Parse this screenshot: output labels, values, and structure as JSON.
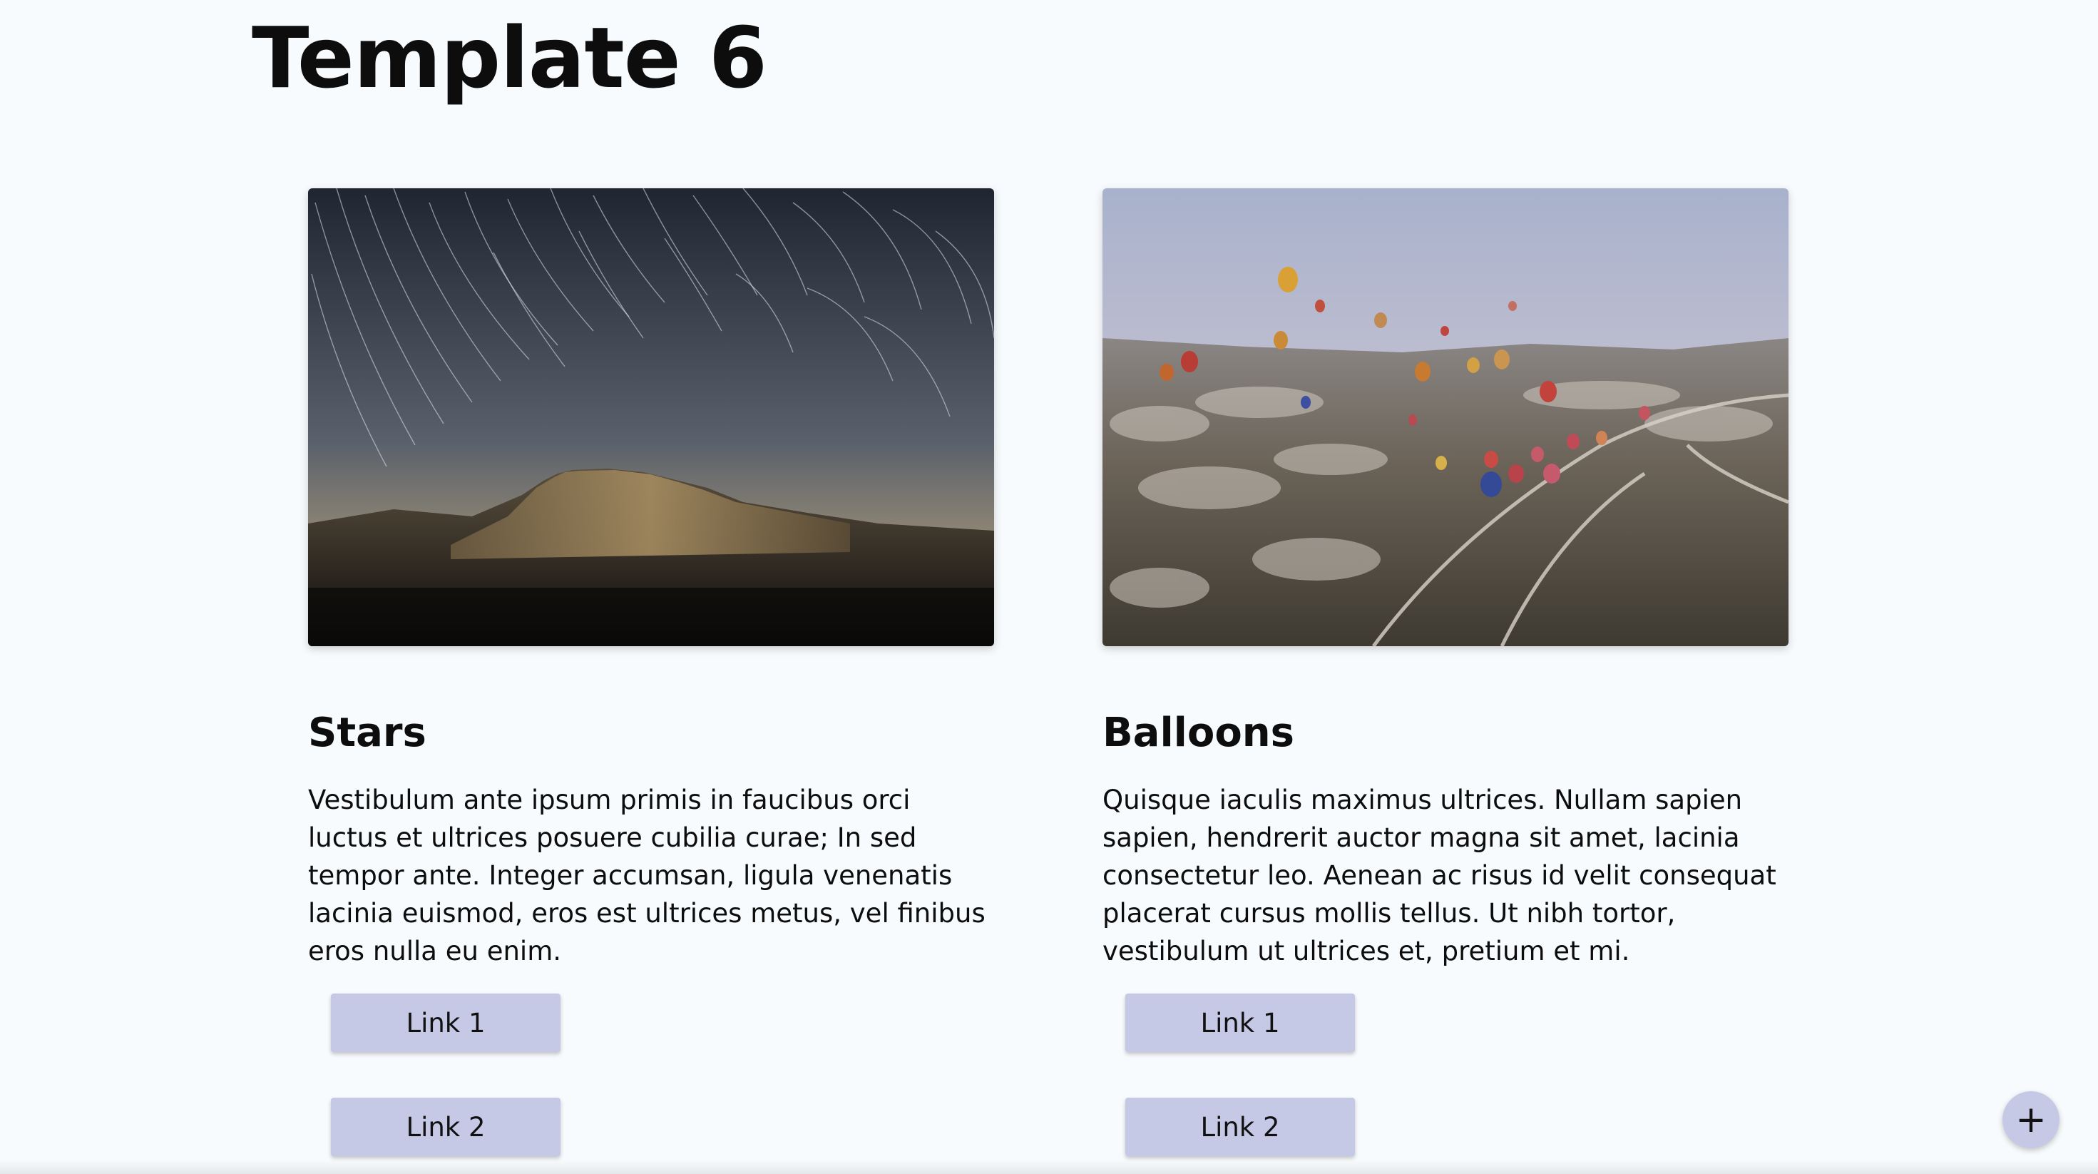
{
  "page": {
    "title": "Template 6"
  },
  "cards": [
    {
      "title": "Stars",
      "image_icon": "star-trails-photo",
      "text": "Vestibulum ante ipsum primis in faucibus orci luctus et ultrices posuere cubilia curae; In sed tempor ante. Integer accumsan, ligula venenatis lacinia euismod, eros est ultrices metus, vel finibus eros nulla eu enim.",
      "links": [
        "Link 1",
        "Link 2"
      ]
    },
    {
      "title": "Balloons",
      "image_icon": "hot-air-balloons-photo",
      "text": "Quisque iaculis maximus ultrices. Nullam sapien sapien, hendrerit auctor magna sit amet, lacinia consectetur leo. Aenean ac risus id velit consequat placerat cursus mollis tellus. Ut nibh tortor, vestibulum ut ultrices et, pretium et mi.",
      "links": [
        "Link 1",
        "Link 2"
      ]
    }
  ],
  "fab": {
    "label": "+",
    "icon": "plus-icon"
  },
  "colors": {
    "background": "#f8fbfd",
    "button": "#c5c9e6",
    "text": "#0d0d0d"
  }
}
